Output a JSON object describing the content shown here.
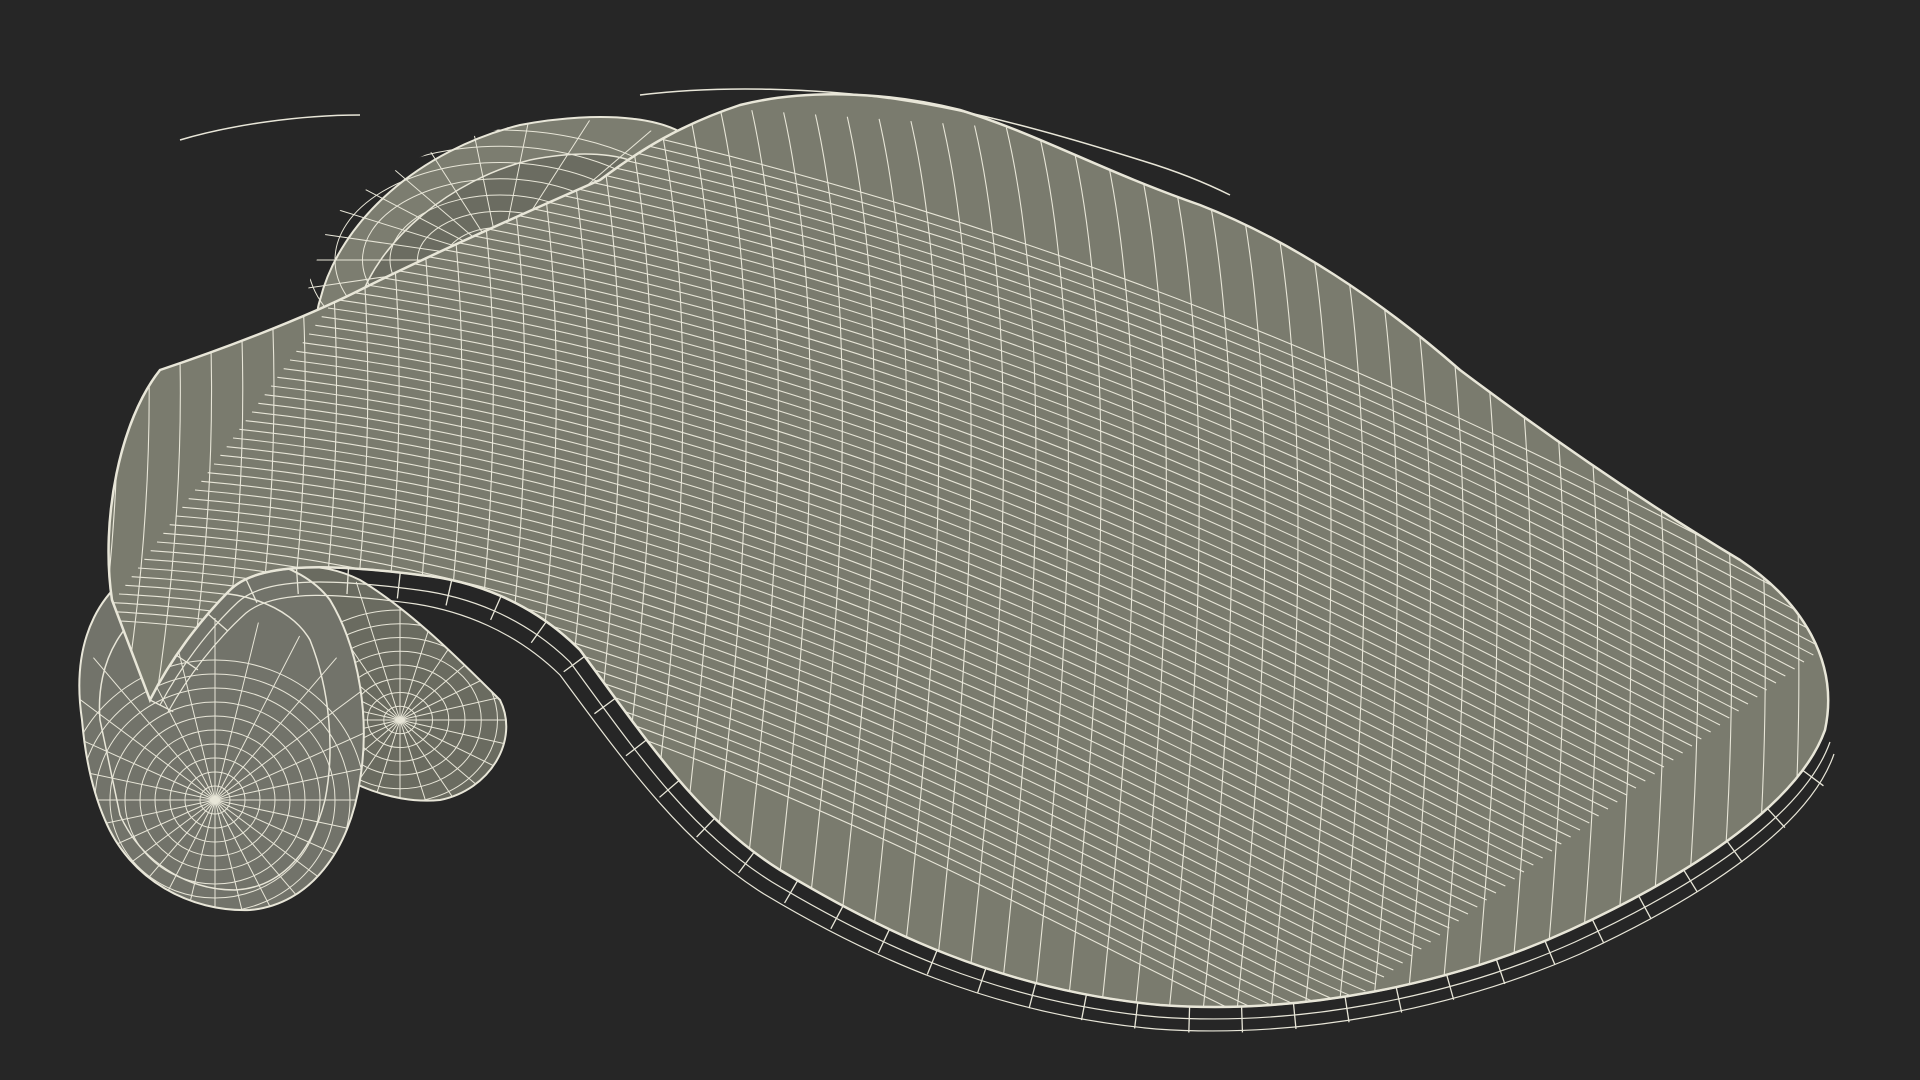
{
  "scene": {
    "subject": "wireframe-mesh",
    "colors": {
      "background": "#262626",
      "surface": "#7a7b6e",
      "surface_dark": "#5f6056",
      "interior": "#6c6d62",
      "wire": "#e8e6d8",
      "rim": "#8a8b7e"
    }
  }
}
